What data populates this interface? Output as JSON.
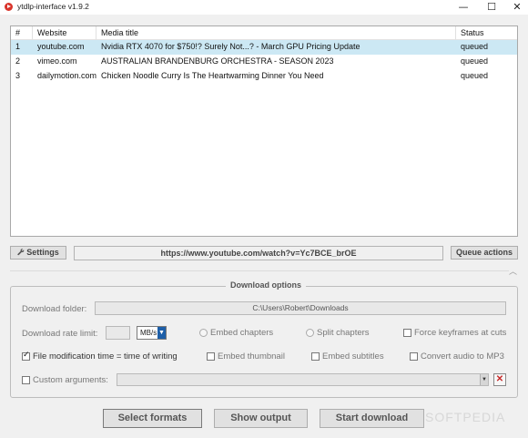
{
  "window": {
    "title": "ytdlp-interface v1.9.2",
    "controls": {
      "minimize": "—",
      "maximize": "☐",
      "close": "✕"
    }
  },
  "table": {
    "headers": [
      "#",
      "Website",
      "Media title",
      "Status"
    ],
    "rows": [
      {
        "num": "1",
        "website": "youtube.com",
        "title": "Nvidia RTX 4070 for $750!? Surely Not...? - March GPU Pricing Update",
        "status": "queued",
        "selected": true
      },
      {
        "num": "2",
        "website": "vimeo.com",
        "title": "AUSTRALIAN BRANDENBURG ORCHESTRA - SEASON 2023",
        "status": "queued",
        "selected": false
      },
      {
        "num": "3",
        "website": "dailymotion.com",
        "title": "Chicken Noodle Curry Is The Heartwarming Dinner You Need",
        "status": "queued",
        "selected": false
      }
    ]
  },
  "toolbar": {
    "settings_label": "Settings",
    "url": "https://www.youtube.com/watch?v=Yc7BCE_brOE",
    "queue_actions_label": "Queue actions"
  },
  "options": {
    "group_title": "Download options",
    "folder_label": "Download folder:",
    "folder_value": "C:\\Users\\Robert\\Downloads",
    "rate_label": "Download rate limit:",
    "rate_value": "",
    "rate_unit": "MB/s",
    "embed_chapters": "Embed chapters",
    "split_chapters": "Split chapters",
    "force_keyframes": "Force keyframes at cuts",
    "file_mod_time": "File modification time = time of writing",
    "file_mod_time_checked": true,
    "embed_thumbnail": "Embed thumbnail",
    "embed_subtitles": "Embed subtitles",
    "convert_mp3": "Convert audio to MP3",
    "custom_args": "Custom arguments:"
  },
  "buttons": {
    "select_formats": "Select formats",
    "show_output": "Show output",
    "start_download": "Start download"
  },
  "watermark": "SOFTPEDIA",
  "colors": {
    "selection": "#cce8f4",
    "accent": "#1e5fa8",
    "clear_red": "#c62828"
  }
}
